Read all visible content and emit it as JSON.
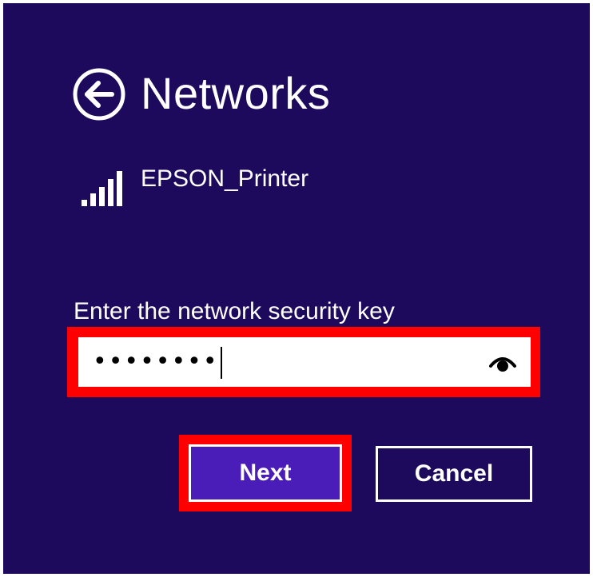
{
  "header": {
    "back_icon": "arrow-left-circle-icon",
    "title": "Networks"
  },
  "network": {
    "icon": "wifi-signal-full-icon",
    "name": "EPSON_Printer"
  },
  "security_key": {
    "label": "Enter the network security key",
    "masked_value": "••••••••",
    "reveal_icon": "eye-reveal-icon"
  },
  "buttons": {
    "next_label": "Next",
    "cancel_label": "Cancel"
  },
  "colors": {
    "background": "#1e0a5c",
    "accent_button": "#4a1db8",
    "highlight": "#ff0000",
    "text": "#ffffff"
  }
}
